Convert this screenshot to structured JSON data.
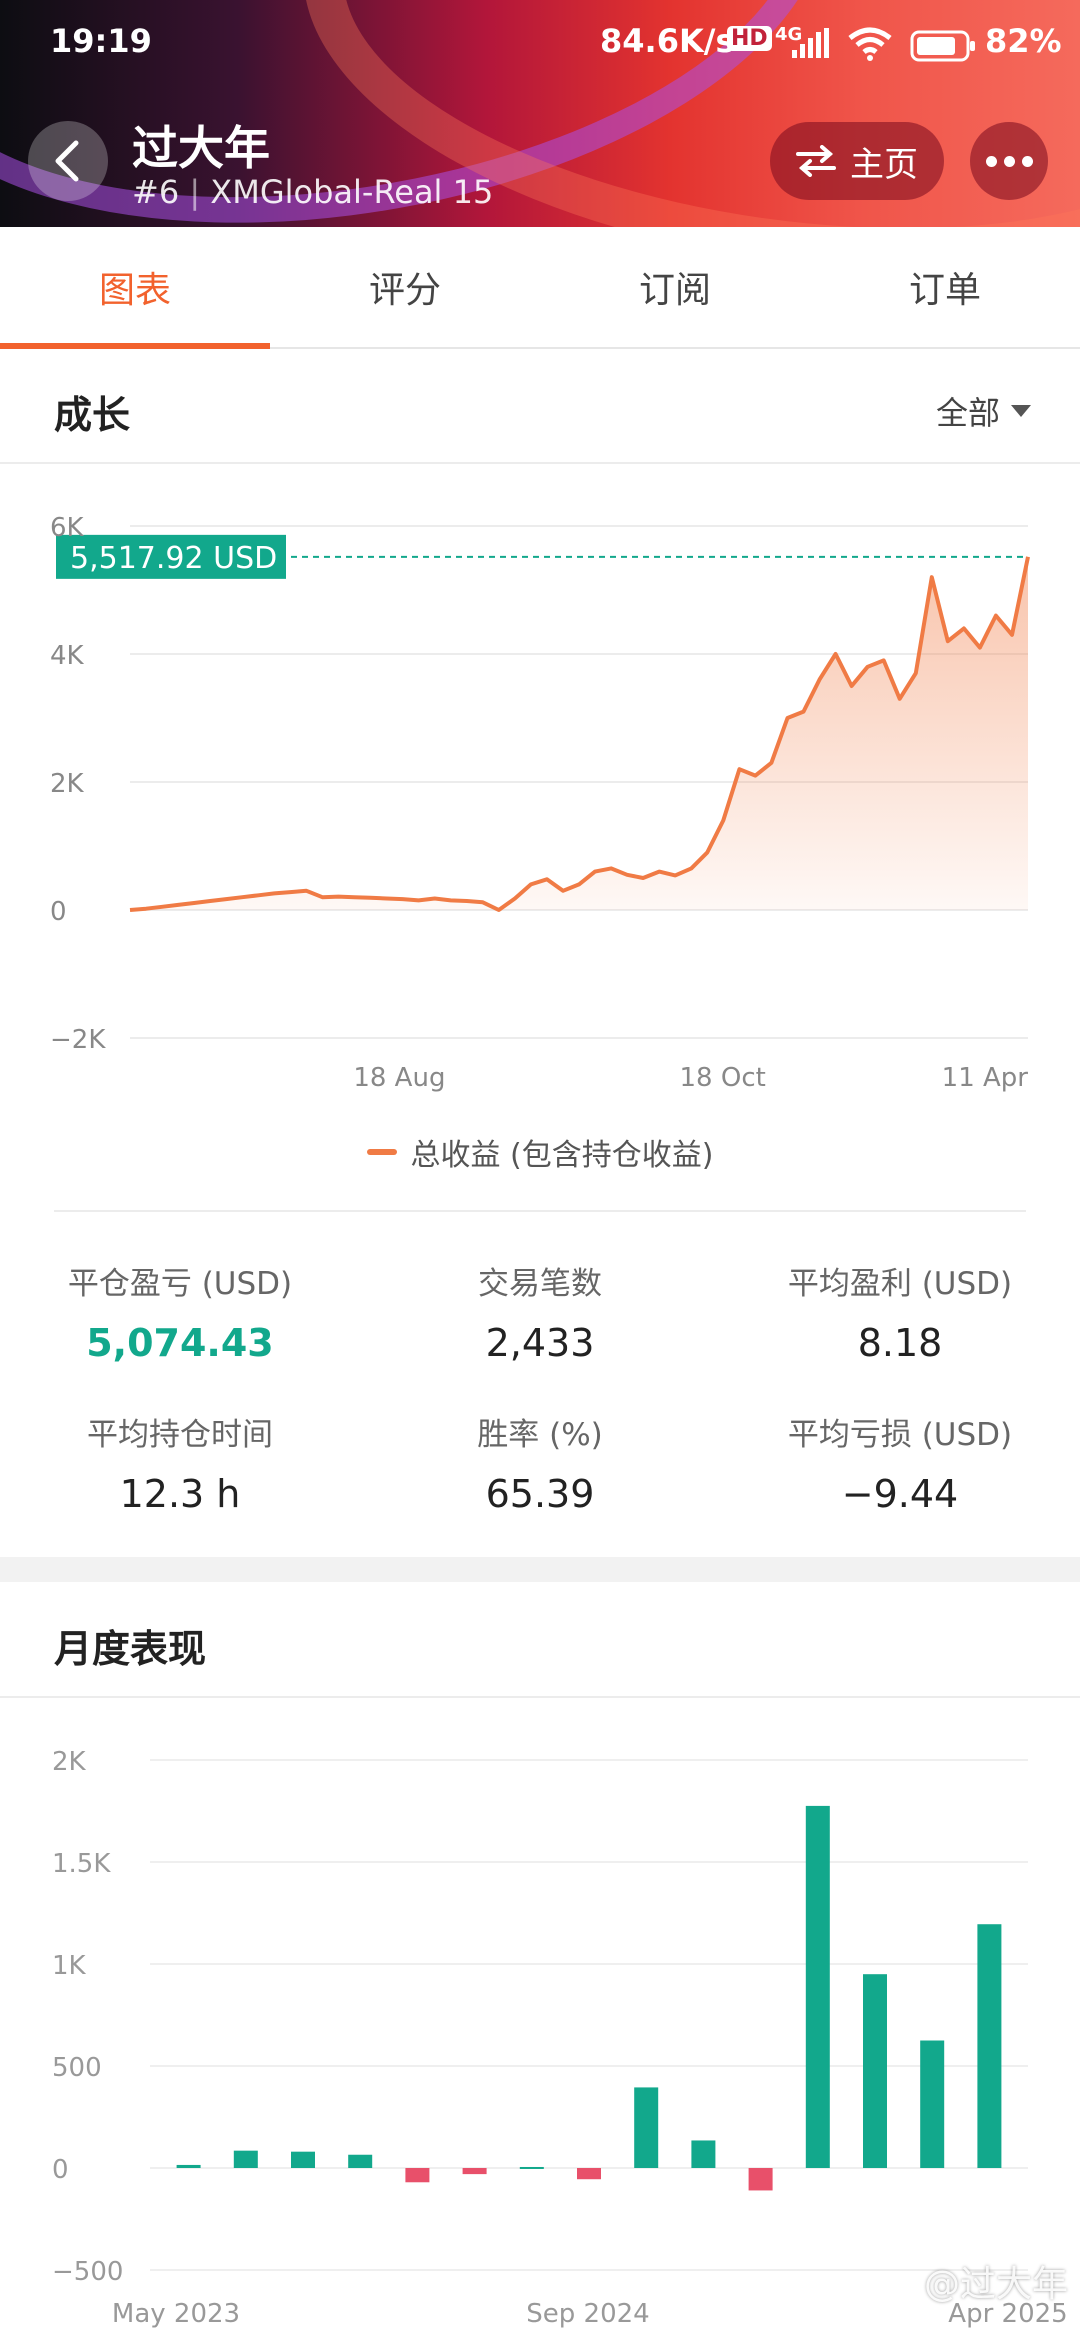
{
  "status_bar": {
    "time": "19:19",
    "net_speed": "84.6K/s",
    "hd": "HD",
    "net_type": "4G",
    "battery": "82%"
  },
  "header": {
    "title": "过大年",
    "rank": "#6",
    "account": "XMGlobal-Real 15",
    "home_label": "主页"
  },
  "tabs": [
    {
      "label": "图表"
    },
    {
      "label": "评分"
    },
    {
      "label": "订阅"
    },
    {
      "label": "订单"
    }
  ],
  "growth": {
    "title": "成长",
    "filter": "全部",
    "current_value": "5,517.92 USD",
    "legend": "总收益 (包含持仓收益)"
  },
  "stats": [
    {
      "label": "平仓盈亏 (USD)",
      "value": "5,074.43"
    },
    {
      "label": "交易笔数",
      "value": "2,433"
    },
    {
      "label": "平均盈利 (USD)",
      "value": "8.18"
    },
    {
      "label": "平均持仓时间",
      "value": "12.3 h"
    },
    {
      "label": "胜率 (%)",
      "value": "65.39"
    },
    {
      "label": "平均亏损 (USD)",
      "value": "−9.44"
    }
  ],
  "monthly": {
    "title": "月度表现"
  },
  "watermark": "@过大年",
  "colors": {
    "accent": "#f2622d",
    "line": "#f07b45",
    "positive": "#12a88c",
    "negative": "#e8506a"
  },
  "chart_data": [
    {
      "type": "area",
      "series": [
        {
          "name": "总收益 (包含持仓收益)",
          "y": [
            0,
            20,
            50,
            80,
            110,
            140,
            170,
            200,
            230,
            260,
            280,
            300,
            200,
            210,
            200,
            190,
            180,
            170,
            150,
            180,
            150,
            140,
            120,
            0,
            180,
            400,
            480,
            300,
            400,
            600,
            650,
            550,
            500,
            600,
            540,
            650,
            900,
            1400,
            2200,
            2100,
            2300,
            3000,
            3100,
            3600,
            4000,
            3500,
            3800,
            3900,
            3300,
            3700,
            5200,
            4200,
            4400,
            4100,
            4600,
            4300,
            5518
          ]
        }
      ],
      "x_tick_labels": [
        "18 Aug",
        "18 Oct",
        "11 Apr"
      ],
      "y_tick_labels": [
        "6K",
        "4K",
        "2K",
        "0",
        "−2K"
      ],
      "ylim": [
        -2000,
        6000
      ],
      "marker_value": 5517.92,
      "grid": true,
      "legend_position": "bottom"
    },
    {
      "type": "bar",
      "values": [
        15,
        85,
        80,
        65,
        -70,
        -30,
        5,
        -55,
        395,
        135,
        -110,
        1775,
        950,
        625,
        1195
      ],
      "x_tick_labels": [
        "May 2023",
        "Sep 2024",
        "Apr 2025"
      ],
      "y_tick_labels": [
        "2K",
        "1.5K",
        "1K",
        "500",
        "0",
        "−500"
      ],
      "ylim": [
        -500,
        2000
      ],
      "grid": true
    }
  ]
}
